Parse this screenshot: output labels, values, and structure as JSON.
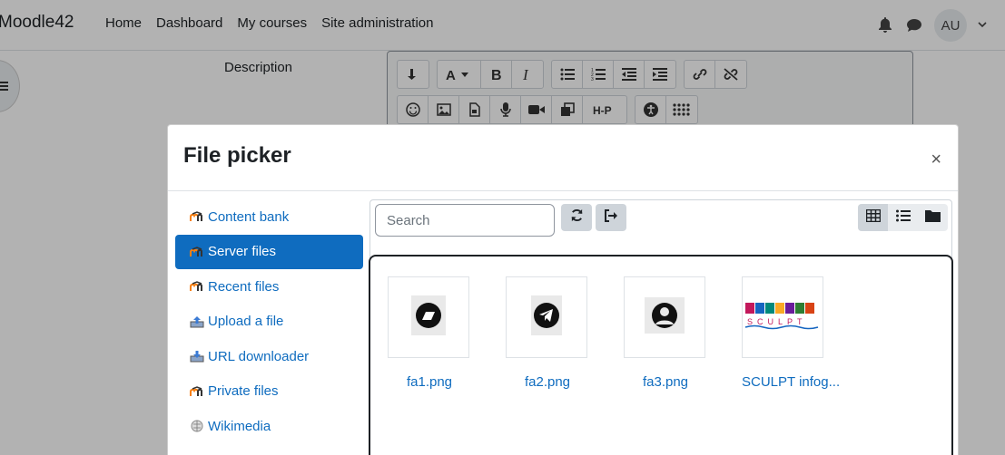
{
  "navbar": {
    "brand": "Moodle42",
    "links": [
      "Home",
      "Dashboard",
      "My courses",
      "Site administration"
    ],
    "avatar_initials": "AU"
  },
  "form": {
    "description_label": "Description"
  },
  "modal": {
    "title": "File picker",
    "close_label": "×",
    "repositories": [
      {
        "label": "Content bank",
        "icon": "moodle-icon",
        "active": false
      },
      {
        "label": "Server files",
        "icon": "moodle-icon",
        "active": true
      },
      {
        "label": "Recent files",
        "icon": "moodle-icon",
        "active": false
      },
      {
        "label": "Upload a file",
        "icon": "upload-icon",
        "active": false
      },
      {
        "label": "URL downloader",
        "icon": "url-download-icon",
        "active": false
      },
      {
        "label": "Private files",
        "icon": "moodle-icon",
        "active": false
      },
      {
        "label": "Wikimedia",
        "icon": "wikimedia-icon",
        "active": false
      }
    ],
    "search_placeholder": "Search",
    "files": [
      {
        "name": "fa1.png",
        "icon": "fa1-icon"
      },
      {
        "name": "fa2.png",
        "icon": "telegram-icon"
      },
      {
        "name": "fa3.png",
        "icon": "user-circle-icon"
      },
      {
        "name": "SCULPT infog...",
        "icon": "sculpt-thumbnail"
      }
    ]
  },
  "colors": {
    "link": "#0f6cbf",
    "active_bg": "#0f6cbf"
  }
}
